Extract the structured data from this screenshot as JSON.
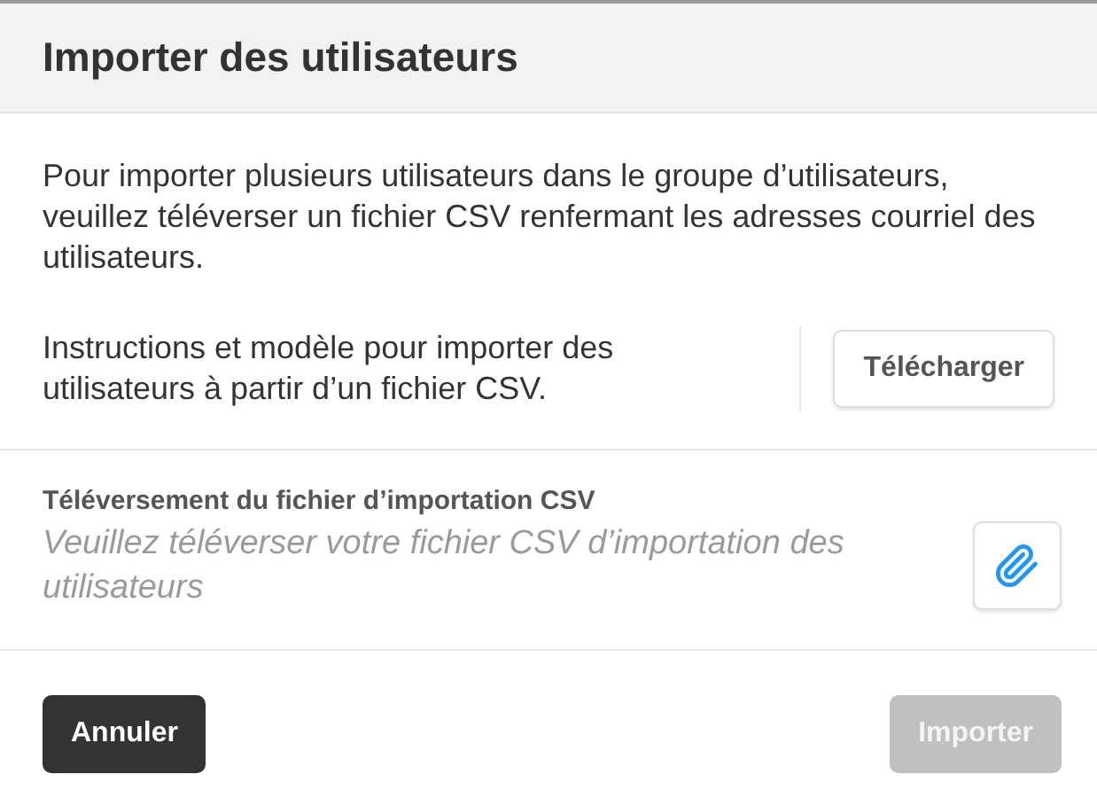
{
  "dialog": {
    "title": "Importer des utilisateurs",
    "intro": "Pour importer plusieurs utilisateurs dans le groupe d’utilisateurs, veuillez téléverser un fichier CSV renfermant les adresses courriel des utilisateurs.",
    "instructions": {
      "text": "Instructions et modèle pour importer des utilisateurs à partir d’un fichier CSV.",
      "button": "Télécharger"
    },
    "upload": {
      "label": "Téléversement du fichier d’importation CSV",
      "placeholder": "Veuillez téléverser votre fichier CSV d’importation des utilisateurs"
    },
    "buttons": [
      {
        "label": "Annuler",
        "kind": "secondary",
        "disabled": false
      },
      {
        "label": "Importer",
        "kind": "primary",
        "disabled": true
      }
    ]
  }
}
